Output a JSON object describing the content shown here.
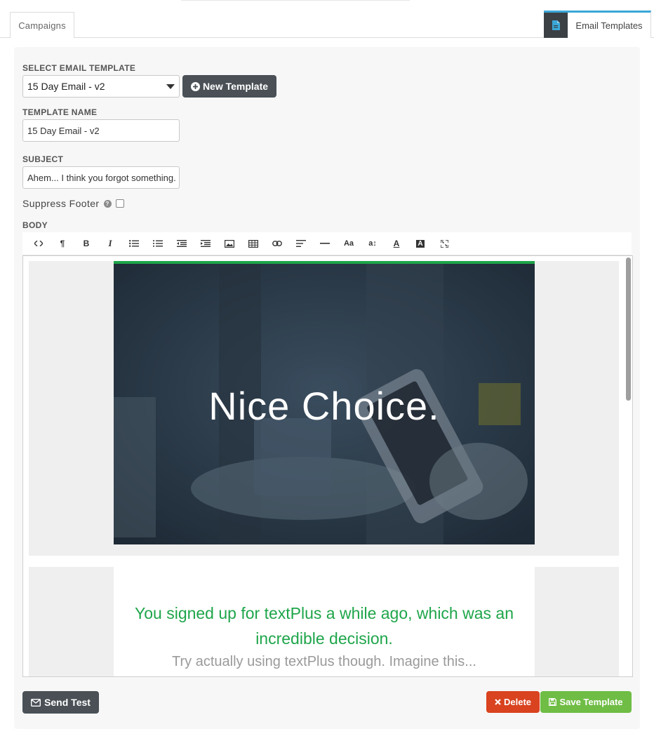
{
  "tabs": {
    "campaigns": "Campaigns",
    "email_templates": "Email Templates"
  },
  "form": {
    "select_label": "SELECT EMAIL TEMPLATE",
    "selected_template": "15 Day Email - v2",
    "new_template_label": "New Template",
    "name_label": "TEMPLATE NAME",
    "name_value": "15 Day Email - v2",
    "subject_label": "SUBJECT",
    "subject_value": "Ahem... I think you forgot something.",
    "suppress_footer_label": "Suppress Footer",
    "suppress_footer_checked": false,
    "body_label": "BODY"
  },
  "toolbar": {
    "tools": [
      "code-view",
      "paragraph",
      "bold",
      "italic",
      "unordered-list",
      "ordered-list",
      "outdent",
      "indent",
      "image",
      "table",
      "link",
      "align",
      "horizontal-rule",
      "font-size",
      "line-height",
      "font-color",
      "background-color",
      "fullscreen"
    ]
  },
  "email": {
    "hero_title": "Nice Choice.",
    "headline": "You signed up for textPlus a while ago, which was an incredible decision.",
    "subtext": "Try actually using textPlus though. Imagine this..."
  },
  "actions": {
    "send_test": "Send Test",
    "delete": "Delete",
    "save": "Save Template"
  },
  "colors": {
    "accent_blue": "#3aa7d8",
    "dark_button": "#4a5056",
    "delete_red": "#d9431f",
    "save_green": "#6fbd45",
    "brand_green": "#1ea54a"
  }
}
